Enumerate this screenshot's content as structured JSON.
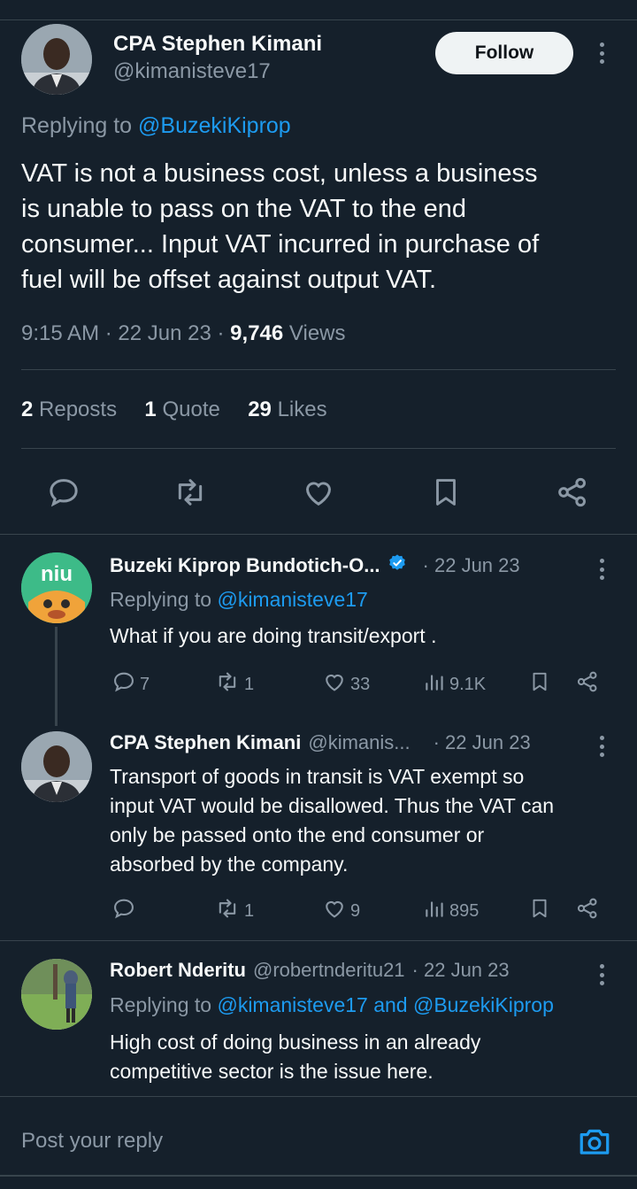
{
  "main_tweet": {
    "author_name": "CPA Stephen Kimani",
    "author_handle": "@kimanisteve17",
    "follow_label": "Follow",
    "replying_prefix": "Replying to",
    "replying_to": "@BuzekiKiprop",
    "body_lines": [
      "VAT is not a business cost, unless a business",
      "is unable to pass on the VAT to the end",
      "consumer... Input VAT incurred in purchase of",
      "fuel will be offset against output VAT."
    ],
    "time": "9:15 AM",
    "date": "22 Jun 23",
    "views_count": "9,746",
    "views_label": "Views",
    "reposts_count": "2",
    "reposts_label": "Reposts",
    "quotes_count": "1",
    "quotes_label": "Quote",
    "likes_count": "29",
    "likes_label": "Likes",
    "actions": [
      "reply-icon",
      "repost-icon",
      "like-icon",
      "bookmark-icon",
      "share-icon"
    ]
  },
  "replies": [
    {
      "name": "Buzeki Kiprop Bundotich-O...",
      "verified": true,
      "handle": "",
      "date": "· 22 Jun 23",
      "replying_prefix": "Replying to",
      "replying_to": "@kimanisteve17",
      "avatar_text": "niu",
      "text_lines": [
        "What if you are doing transit/export ."
      ],
      "replies": "7",
      "reposts": "1",
      "likes": "33",
      "views": "9.1K"
    },
    {
      "name": "CPA Stephen Kimani",
      "verified": false,
      "handle": "@kimanis...",
      "date": "· 22 Jun 23",
      "text_lines": [
        "Transport of goods in transit is VAT exempt so",
        "input VAT would be disallowed. Thus the VAT can",
        "only be passed onto the end consumer or",
        "absorbed by the company."
      ],
      "replies": "",
      "reposts": "1",
      "likes": "9",
      "views": "895"
    },
    {
      "name": "Robert Nderitu",
      "verified": false,
      "handle": "@robertnderitu21",
      "date": "· 22 Jun 23",
      "replying_prefix": "Replying to",
      "replying_to": "@kimanisteve17 and @BuzekiKiprop",
      "text_lines": [
        "High cost of doing business in an already",
        "competitive sector is the issue here."
      ]
    }
  ],
  "composer": {
    "placeholder": "Post your reply",
    "camera_icon": "camera-icon"
  },
  "colors": {
    "background": "#15202b",
    "accent": "#1d9bf0",
    "muted": "#8b98a5",
    "divider": "#38444d"
  }
}
